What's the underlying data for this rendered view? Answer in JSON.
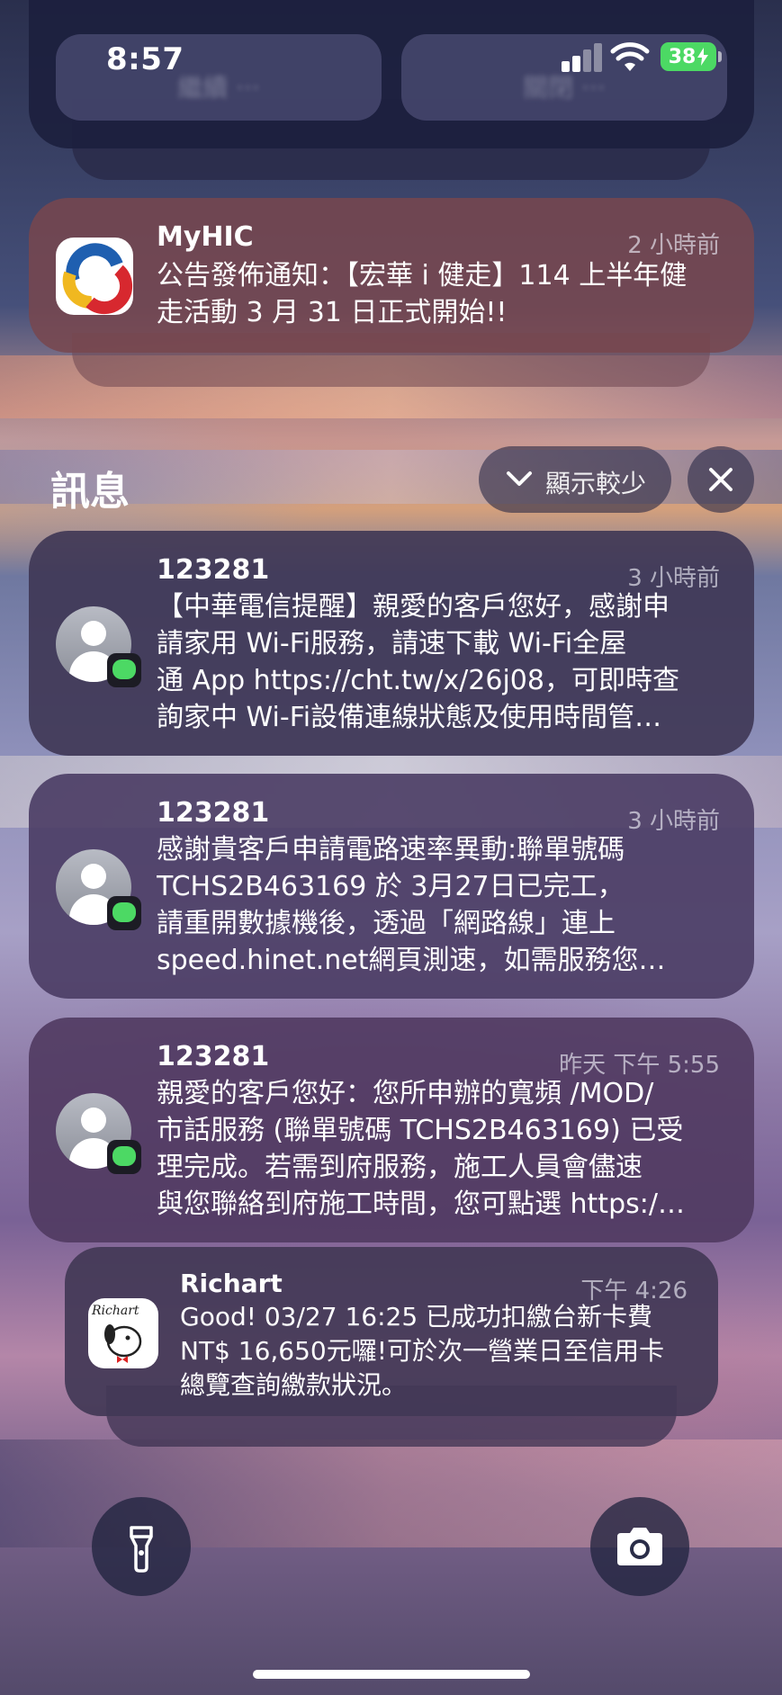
{
  "status_bar": {
    "time": "8:57",
    "battery": "38"
  },
  "top_group": {
    "left_action": "繼續 ···",
    "right_action": "關閉 ···"
  },
  "myhic": {
    "app": "MyHIC",
    "time": "2 小時前",
    "lines": [
      "公告發佈通知：【宏華 i 健走】114 上半年健",
      "走活動 3 月 31 日正式開始!!"
    ]
  },
  "messages_section": {
    "title": "訊息",
    "show_less": "顯示較少"
  },
  "messages": [
    {
      "sender": "123281",
      "time": "3 小時前",
      "lines": [
        "【中華電信提醒】親愛的客戶您好，感謝申",
        "請家用 Wi-Fi服務，請速下載 Wi-Fi全屋",
        "通 App https://cht.tw/x/26j08，可即時查",
        "詢家中 Wi-Fi設備連線狀態及使用時間管…"
      ]
    },
    {
      "sender": "123281",
      "time": "3 小時前",
      "lines": [
        "感謝貴客戶申請電路速率異動:聯單號碼",
        "TCHS2B463169 於 3月27日已完工，",
        "請重開數據機後，透過「網路線」連上",
        "speed.hinet.net網頁測速，如需服務您…"
      ]
    },
    {
      "sender": "123281",
      "time": "昨天 下午 5:55",
      "lines": [
        "親愛的客戶您好：您所申辦的寬頻 /MOD/",
        "市話服務 (聯單號碼 TCHS2B463169) 已受",
        "理完成。若需到府服務，施工人員會儘速",
        "與您聯絡到府施工時間，您可點選 https:/…"
      ]
    }
  ],
  "richart": {
    "app": "Richart",
    "time": "下午 4:26",
    "lines": [
      "Good! 03/27 16:25 已成功扣繳台新卡費",
      "NT$ 16,650元囉!可於次一營業日至信用卡",
      "總覽查詢繳款狀況。"
    ],
    "icon_text": "Richart"
  },
  "icons": {
    "flashlight": "flashlight-icon",
    "camera": "camera-icon",
    "close": "close-icon",
    "chevron": "chevron-down-icon",
    "contact": "contact-avatar-icon",
    "messages_badge": "messages-app-badge-icon",
    "wifi": "wifi-icon",
    "signal": "cellular-signal-icon",
    "battery": "battery-icon"
  },
  "colors": {
    "battery": "#4cd964",
    "messages_badge": "#4cd964",
    "card_bg": "#3d344f"
  }
}
